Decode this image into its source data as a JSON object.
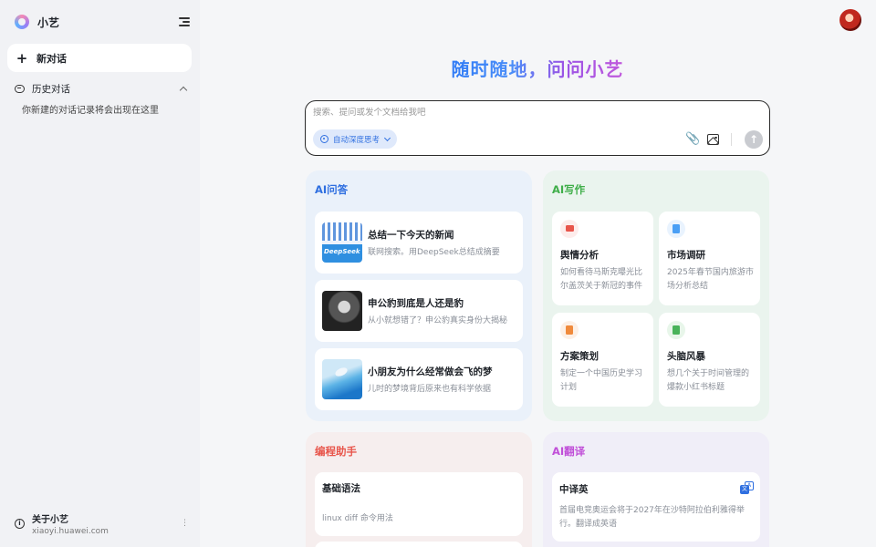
{
  "sidebar": {
    "app_name": "小艺",
    "new_chat_label": "新对话",
    "history_label": "历史对话",
    "history_empty": "你新建的对话记录将会出现在这里",
    "about_title": "关于小艺",
    "about_url": "xiaoyi.huawei.com"
  },
  "main": {
    "headline": "随时随地，问问小艺",
    "input": {
      "placeholder": "搜索、提问或发个文档给我吧",
      "value": "",
      "think_mode_label": "自动深度思考"
    }
  },
  "cards": {
    "qa": {
      "title": "AI问答",
      "title_color": "#2f6fe0",
      "items": [
        {
          "title": "总结一下今天的新闻",
          "subtitle": "联网搜索。用DeepSeek总结成摘要",
          "thumb_text": "DeepSeek"
        },
        {
          "title": "申公豹到底是人还是豹",
          "subtitle": "从小就想错了？申公豹真实身份大揭秘"
        },
        {
          "title": "小朋友为什么经常做会飞的梦",
          "subtitle": "儿时的梦境背后原来也有科学依据"
        }
      ]
    },
    "write": {
      "title": "AI写作",
      "title_color": "#3fae49",
      "items": [
        {
          "title": "舆情分析",
          "subtitle": "如何看待马斯克曝光比尔盖茨关于新冠的事件",
          "icon_color": "#e8554b",
          "icon_bg": "#fdeceb"
        },
        {
          "title": "市场调研",
          "subtitle": "2025年春节国内旅游市场分析总结",
          "icon_color": "#4a9ff5",
          "icon_bg": "#e9f3fe"
        },
        {
          "title": "方案策划",
          "subtitle": "制定一个中国历史学习计划",
          "icon_color": "#f08a3c",
          "icon_bg": "#fdf0e6"
        },
        {
          "title": "头脑风暴",
          "subtitle": "想几个关于时间管理的爆款小红书标题",
          "icon_color": "#49b35a",
          "icon_bg": "#e8f6ea"
        }
      ]
    },
    "code": {
      "title": "编程助手",
      "title_color": "#e8554b",
      "items": [
        {
          "title": "基础语法",
          "subtitle": "linux diff 命令用法"
        }
      ]
    },
    "translate": {
      "title": "AI翻译",
      "title_color": "#c04fd8",
      "items": [
        {
          "title": "中译英",
          "subtitle": "首届电竞奥运会将于2027年在沙特阿拉伯利雅得举行。翻译成英语"
        }
      ]
    }
  }
}
